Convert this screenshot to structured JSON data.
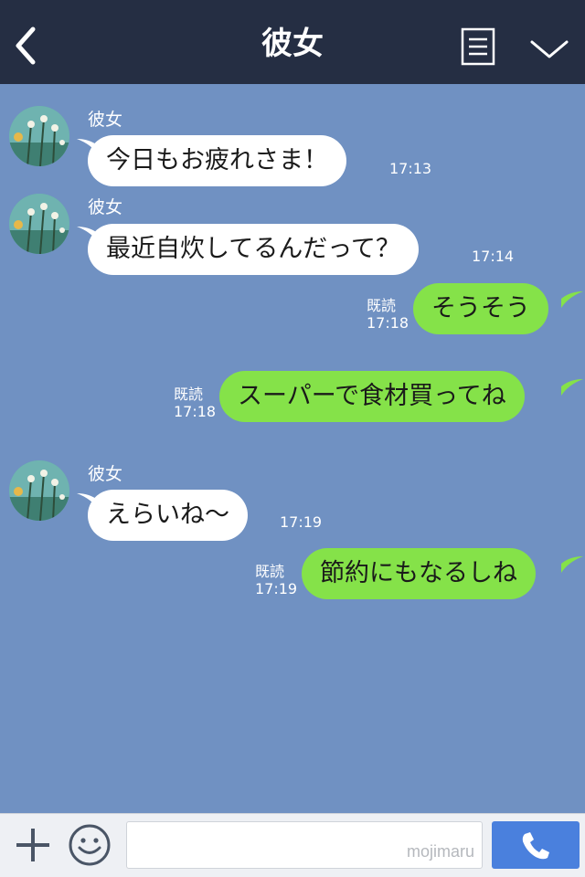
{
  "header": {
    "title": "彼女"
  },
  "messages": [
    {
      "side": "in",
      "sender": "彼女",
      "text": "今日もお疲れさま！",
      "time": "17:13"
    },
    {
      "side": "in",
      "sender": "彼女",
      "text": "最近自炊してるんだって？",
      "time": "17:14"
    },
    {
      "side": "out",
      "text": "そうそう",
      "read": "既読",
      "time": "17:18"
    },
    {
      "side": "out",
      "text": "スーパーで食材買ってね",
      "read": "既読",
      "time": "17:18"
    },
    {
      "side": "in",
      "sender": "彼女",
      "text": "えらいね〜",
      "time": "17:19"
    },
    {
      "side": "out",
      "text": "節約にもなるしね",
      "read": "既読",
      "time": "17:19"
    }
  ],
  "input": {
    "watermark": "mojimaru"
  },
  "colors": {
    "header_bg": "#252e43",
    "chat_bg": "#7091c2",
    "incoming_bubble": "#ffffff",
    "outgoing_bubble": "#85e249",
    "call_button": "#4a80dd"
  },
  "icons": {
    "back": "chevron-left-icon",
    "menu": "list-icon",
    "dropdown": "chevron-down-icon",
    "plus": "plus-icon",
    "emoji": "smiley-icon",
    "call": "phone-icon"
  }
}
